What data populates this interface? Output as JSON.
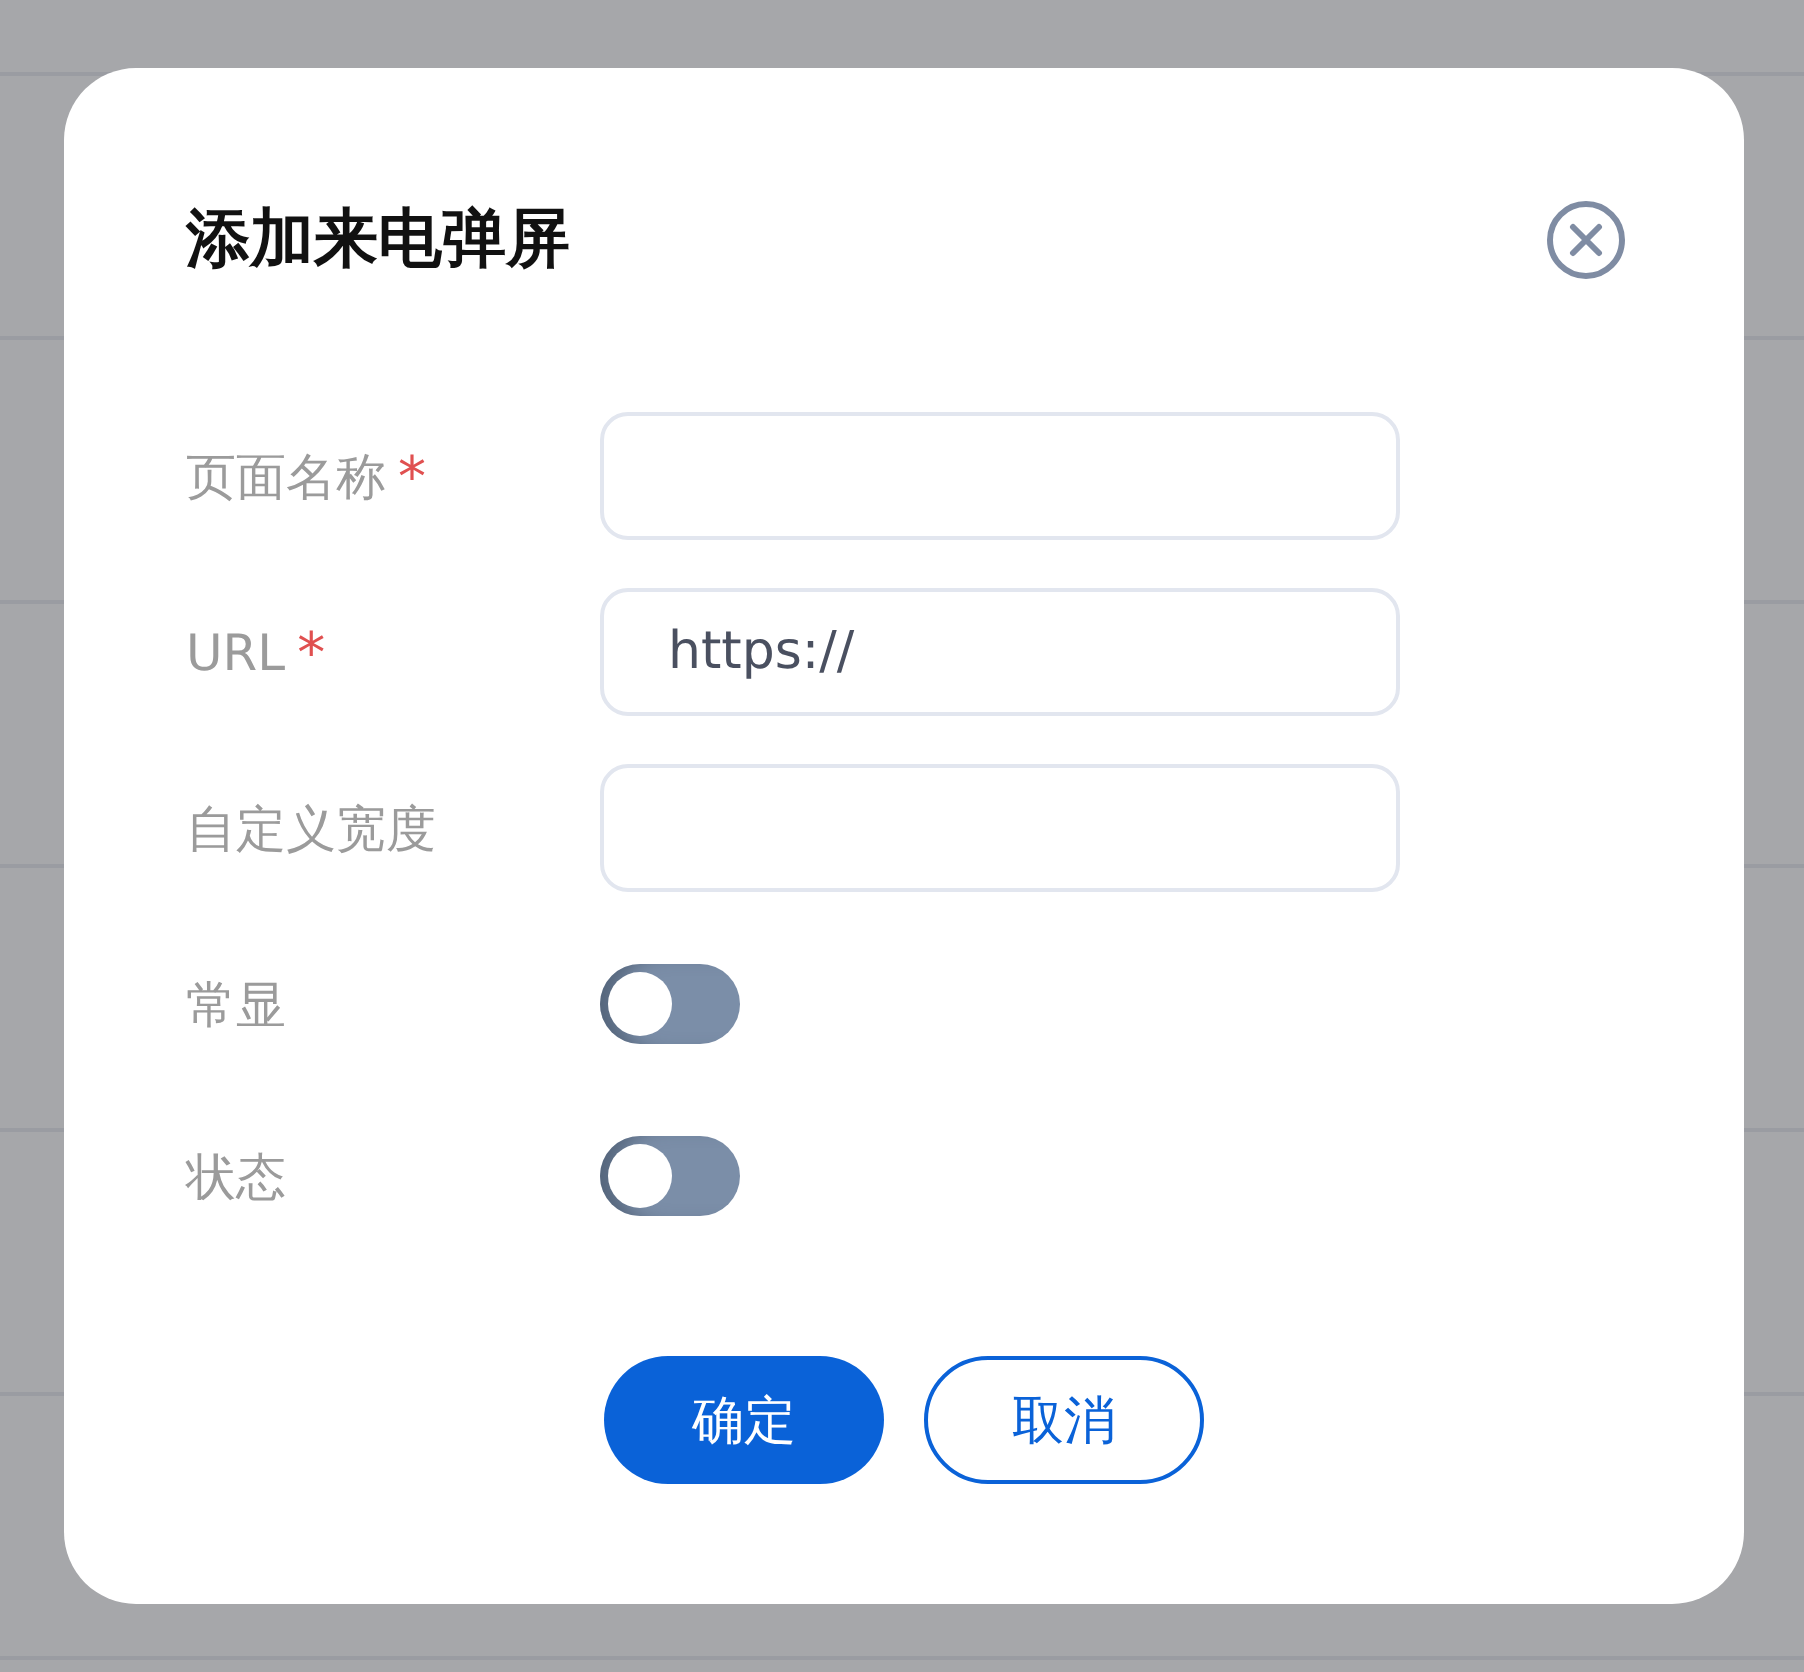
{
  "dialog": {
    "title": "添加来电弹屏"
  },
  "fields": [
    {
      "kind": "text",
      "label": "页面名称",
      "required_mark": "*"
    },
    {
      "kind": "text",
      "label": "URL",
      "required_mark": "*",
      "value": "https://"
    },
    {
      "kind": "text",
      "label": "自定义宽度"
    },
    {
      "kind": "toggle",
      "label": "常显",
      "on": false
    },
    {
      "kind": "toggle",
      "label": "状态",
      "on": false
    }
  ],
  "buttons": [
    {
      "label": "确定",
      "kind": "primary"
    },
    {
      "label": "取消",
      "kind": "secondary"
    }
  ]
}
